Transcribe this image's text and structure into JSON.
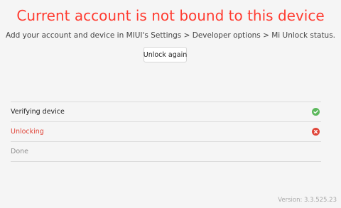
{
  "header": {
    "title": "Current account is not bound to this device",
    "subtitle": "Add your account and device in MIUI's Settings > Developer options > Mi Unlock status."
  },
  "actions": {
    "unlock_again_label": "Unlock again"
  },
  "steps": [
    {
      "label": "Verifying device",
      "status": "success",
      "icon": "check-circle-icon",
      "color": "#5cb85c"
    },
    {
      "label": "Unlocking",
      "status": "error",
      "icon": "x-circle-icon",
      "color": "#e0463a"
    },
    {
      "label": "Done",
      "status": "pending",
      "icon": "",
      "color": "#8e8e8e"
    }
  ],
  "footer": {
    "version": "Version: 3.3.525.23"
  },
  "colors": {
    "error_title": "#ff3b30",
    "success": "#5cb85c",
    "error": "#e0463a",
    "background": "#f5f5f5"
  }
}
